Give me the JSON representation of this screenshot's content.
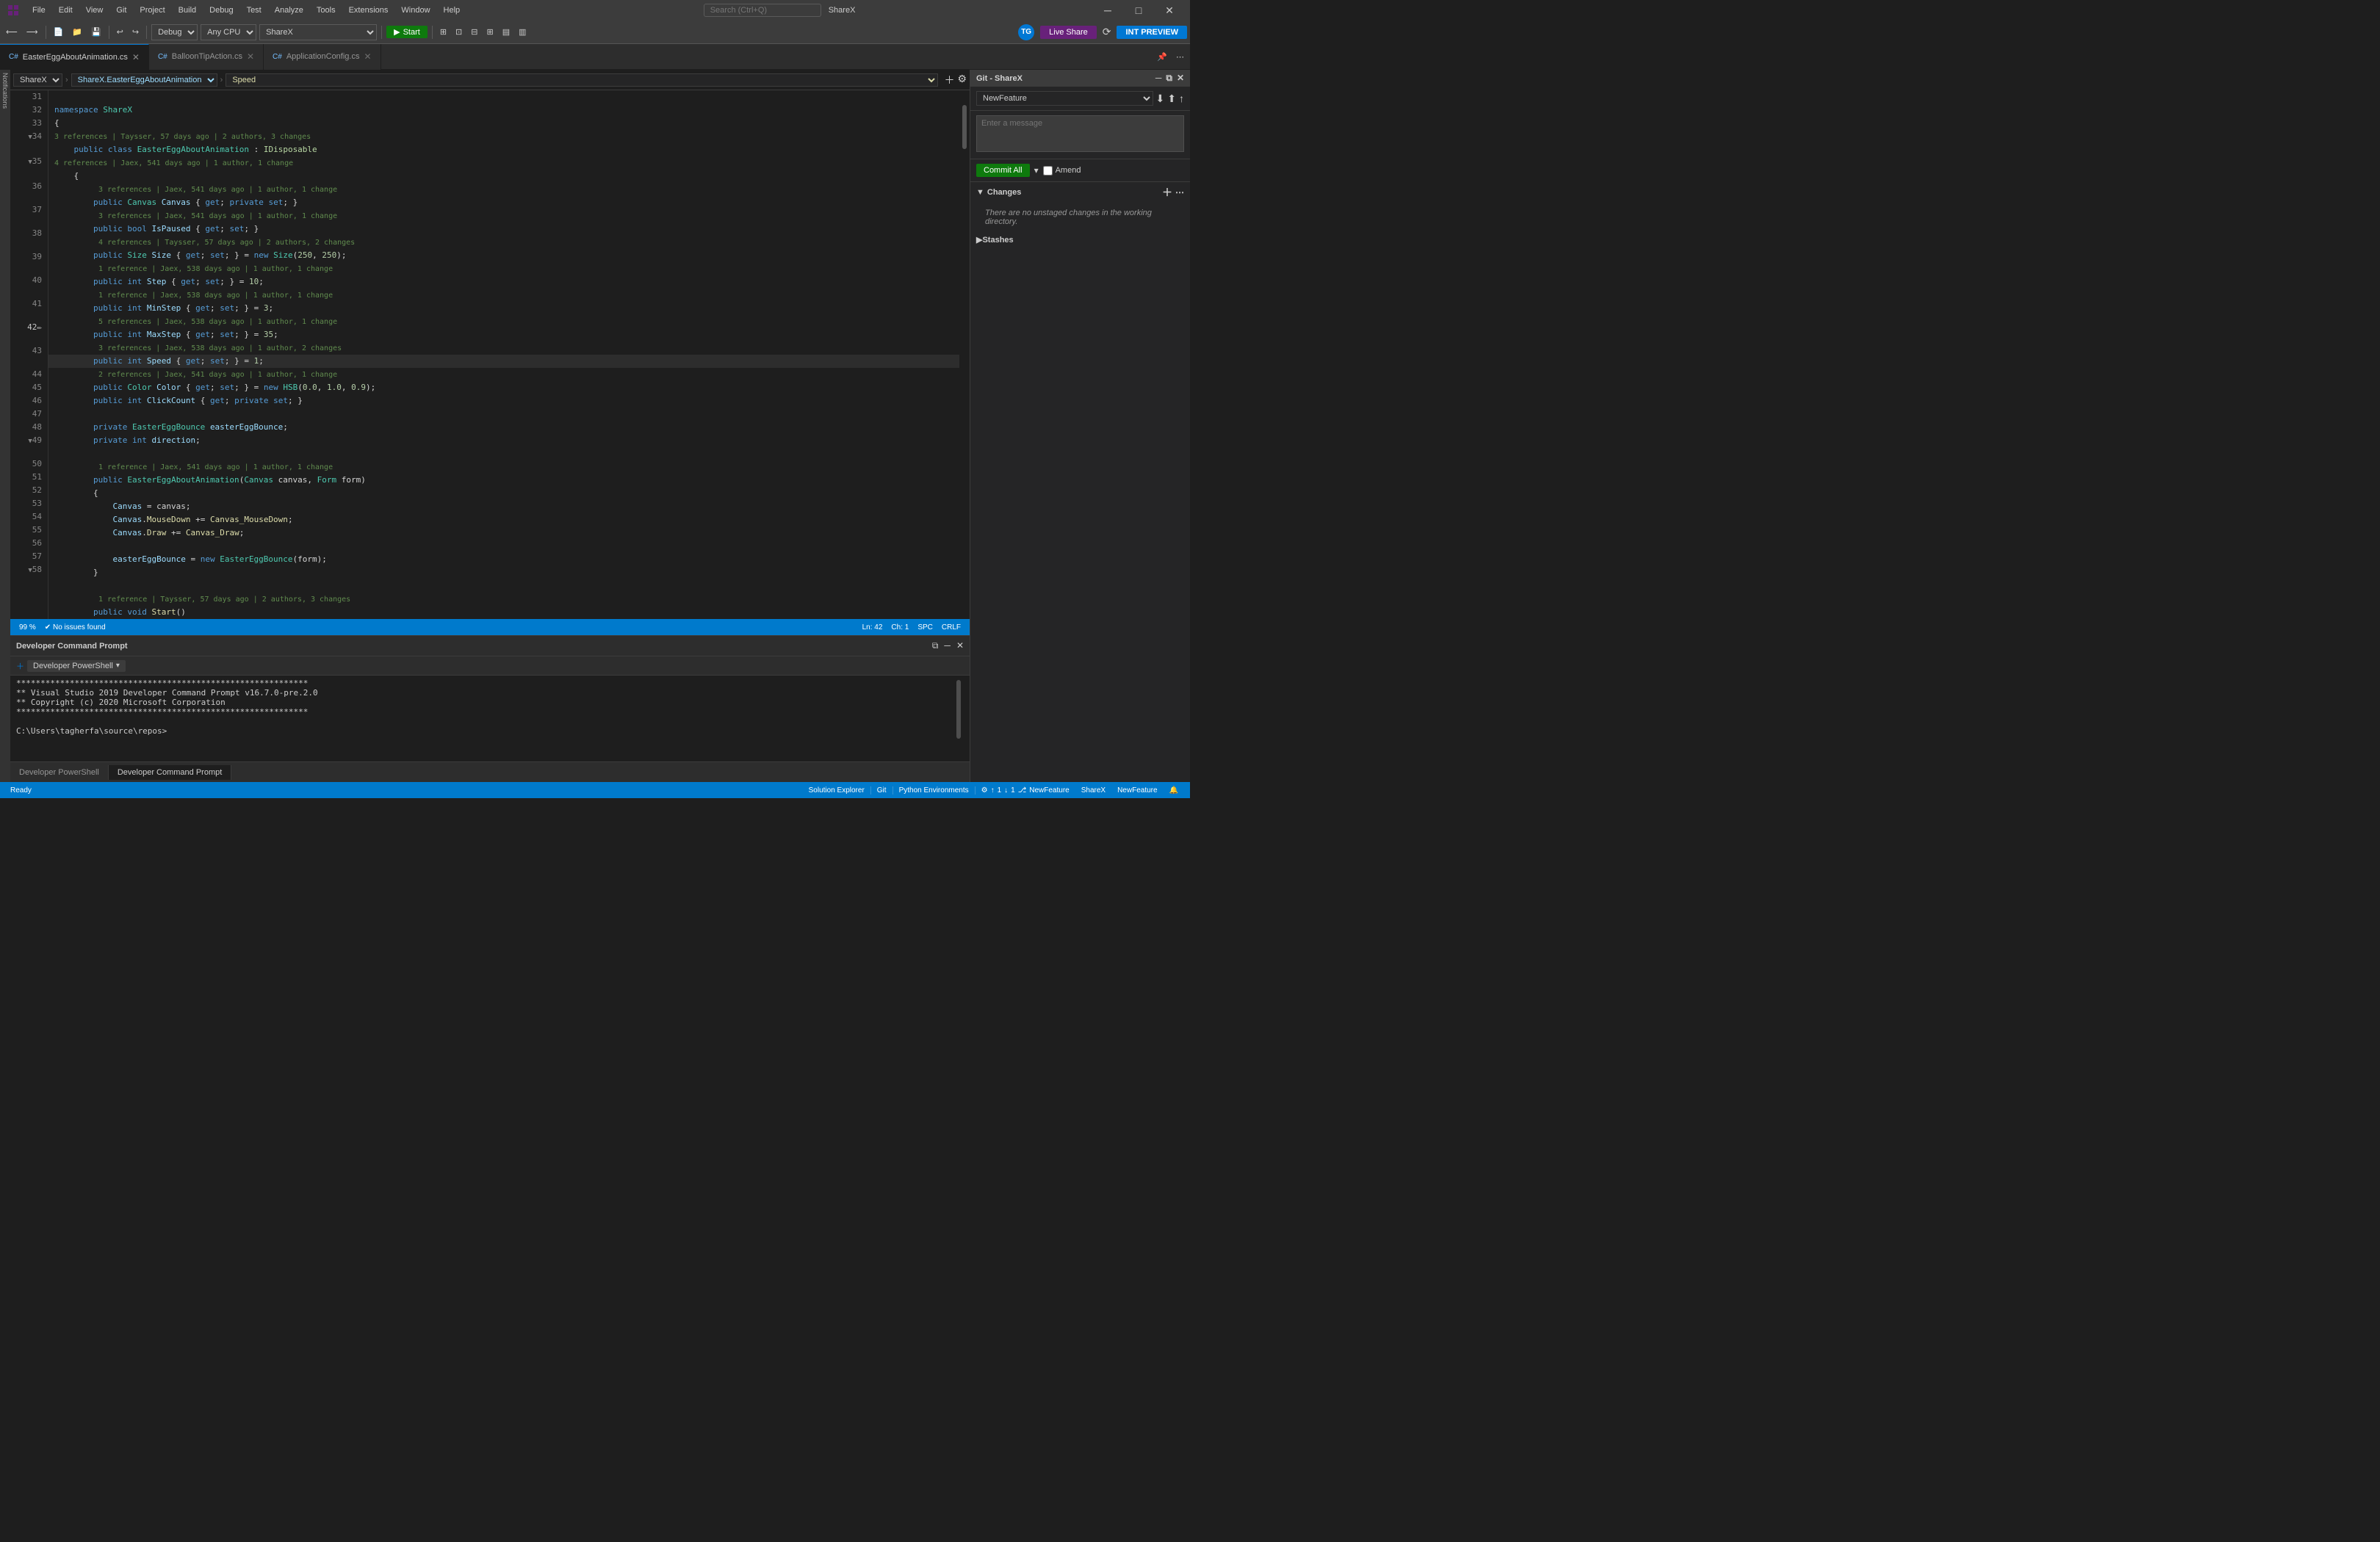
{
  "app": {
    "title": "ShareX",
    "window_title": "ShareX"
  },
  "menubar": {
    "items": [
      "File",
      "Edit",
      "View",
      "Git",
      "Project",
      "Build",
      "Debug",
      "Test",
      "Analyze",
      "Tools",
      "Extensions",
      "Window",
      "Help"
    ],
    "search_placeholder": "Search (Ctrl+Q)"
  },
  "toolbar": {
    "debug_mode": "Debug",
    "platform": "Any CPU",
    "project": "ShareX",
    "start_label": "Start",
    "live_share_label": "Live Share",
    "int_preview_label": "INT PREVIEW",
    "avatar_initials": "TG"
  },
  "tabs": [
    {
      "label": "EasterEggAboutAnimation.cs",
      "active": true,
      "modified": false
    },
    {
      "label": "BalloonTipAction.cs",
      "active": false
    },
    {
      "label": "ApplicationConfig.cs",
      "active": false
    }
  ],
  "editor": {
    "project_dropdown": "ShareX",
    "type_dropdown": "ShareX.EasterEggAboutAnimation",
    "member_dropdown": "Speed",
    "lines": [
      {
        "num": "31",
        "indent": 0,
        "code": ""
      },
      {
        "num": "32",
        "indent": 0,
        "code": "namespace ShareX"
      },
      {
        "num": "33",
        "indent": 0,
        "code": "{"
      },
      {
        "num": "34",
        "indent": 1,
        "code": "public class EasterEggAboutAnimation : IDisposable",
        "meta": "3 references | Taysser, 57 days ago | 2 authors, 3 changes"
      },
      {
        "num": "35",
        "indent": 1,
        "code": "{",
        "meta": "4 references | Jaex, 541 days ago | 1 author, 1 change"
      },
      {
        "num": "36",
        "indent": 2,
        "code": "public Canvas Canvas { get; private set; }",
        "meta": "3 references | Jaex, 541 days ago | 1 author, 1 change"
      },
      {
        "num": "37",
        "indent": 2,
        "code": "public bool IsPaused { get; set; }",
        "meta": "3 references | Jaex, 541 days ago | 1 author, 1 change"
      },
      {
        "num": "38",
        "indent": 2,
        "code": "public Size Size { get; set; } = new Size(250, 250);",
        "meta": "4 references | Taysser, 57 days ago | 2 authors, 2 changes"
      },
      {
        "num": "39",
        "indent": 2,
        "code": "public int Step { get; set; } = 10;",
        "meta": "1 reference | Jaex, 538 days ago | 1 author, 1 change"
      },
      {
        "num": "40",
        "indent": 2,
        "code": "public int MinStep { get; set; } = 3;",
        "meta": "1 reference | Jaex, 538 days ago | 1 author, 1 change"
      },
      {
        "num": "41",
        "indent": 2,
        "code": "public int MaxStep { get; set; } = 35;",
        "meta": "5 references | Jaex, 538 days ago | 1 author, 1 change"
      },
      {
        "num": "42",
        "indent": 2,
        "code": "public int Speed { get; set; } = 1;",
        "current": true,
        "meta": "3 references | Jaex, 538 days ago | 1 author, 2 changes"
      },
      {
        "num": "43",
        "indent": 2,
        "code": "public Color Color { get; set; } = new HSB(0.0, 1.0, 0.9);",
        "meta": "2 references | Jaex, 541 days ago | 1 author, 1 change"
      },
      {
        "num": "44",
        "indent": 2,
        "code": "public int ClickCount { get; private set; }"
      },
      {
        "num": "45",
        "indent": 0,
        "code": ""
      },
      {
        "num": "46",
        "indent": 2,
        "code": "private EasterEggBounce easterEggBounce;"
      },
      {
        "num": "47",
        "indent": 2,
        "code": "private int direction;"
      },
      {
        "num": "48",
        "indent": 0,
        "code": ""
      },
      {
        "num": "49",
        "indent": 2,
        "code": "public EasterEggAboutAnimation(Canvas canvas, Form form)",
        "meta": "1 reference | Jaex, 541 days ago | 1 author, 1 change"
      },
      {
        "num": "50",
        "indent": 2,
        "code": "{"
      },
      {
        "num": "51",
        "indent": 3,
        "code": "Canvas = canvas;"
      },
      {
        "num": "52",
        "indent": 3,
        "code": "Canvas.MouseDown += Canvas_MouseDown;"
      },
      {
        "num": "53",
        "indent": 3,
        "code": "Canvas.Draw += Canvas_Draw;"
      },
      {
        "num": "54",
        "indent": 0,
        "code": ""
      },
      {
        "num": "55",
        "indent": 3,
        "code": "easterEggBounce = new EasterEggBounce(form);"
      },
      {
        "num": "56",
        "indent": 2,
        "code": "}"
      },
      {
        "num": "57",
        "indent": 0,
        "code": ""
      },
      {
        "num": "58",
        "indent": 2,
        "code": "public void Start()",
        "meta": "1 reference | Taysser, 57 days ago | 2 authors, 3 changes"
      }
    ]
  },
  "git_panel": {
    "title": "Git - ShareX",
    "branch": "NewFeature",
    "message_placeholder": "Enter a message",
    "commit_label": "Commit All",
    "amend_label": "Amend",
    "changes_section": "Changes",
    "no_changes_text": "There are no unstaged changes in the working directory.",
    "stashes_section": "Stashes"
  },
  "bottom_panel": {
    "title": "Developer Command Prompt",
    "tabs": [
      {
        "label": "Developer PowerShell",
        "active": false
      },
      {
        "label": "Developer Command Prompt",
        "active": true
      }
    ],
    "terminal_lines": [
      "************************************************************",
      "** Visual Studio 2019 Developer Command Prompt v16.7.0-pre.2.0",
      "** Copyright (c) 2020 Microsoft Corporation",
      "************************************************************",
      "",
      "C:\\Users\\tagherfa\\source\\repos>"
    ]
  },
  "statusbar": {
    "ready": "Ready",
    "zoom": "99 %",
    "issues": "No issues found",
    "line": "Ln: 42",
    "col": "Ch: 1",
    "spaces": "SPC",
    "line_ending": "CRLF",
    "branch": "NewFeature",
    "sharex": "ShareX",
    "solution_explorer": "Solution Explorer",
    "git_tab": "Git",
    "python_environments": "Python Environments"
  }
}
